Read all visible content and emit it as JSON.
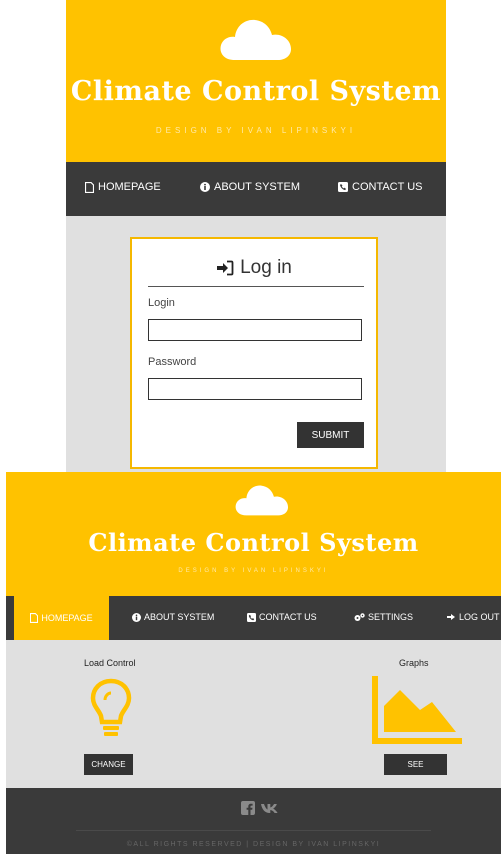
{
  "login_screen": {
    "header": {
      "title": "Climate Control System",
      "subtitle": "DESIGN BY IVAN LIPINSKYI"
    },
    "nav": [
      {
        "label": "HOMEPAGE",
        "icon": "file-icon"
      },
      {
        "label": "ABOUT SYSTEM",
        "icon": "info-icon"
      },
      {
        "label": "CONTACT US",
        "icon": "phone-icon"
      }
    ],
    "form": {
      "title": "Log in",
      "login_label": "Login",
      "login_value": "",
      "password_label": "Password",
      "password_value": "",
      "submit_label": "SUBMIT"
    }
  },
  "dashboard_screen": {
    "header": {
      "title": "Climate Control System",
      "subtitle": "DESIGN BY IVAN LIPINSKYI"
    },
    "nav": [
      {
        "label": "HOMEPAGE",
        "icon": "file-icon",
        "active": true
      },
      {
        "label": "ABOUT SYSTEM",
        "icon": "info-icon"
      },
      {
        "label": "CONTACT US",
        "icon": "phone-icon"
      },
      {
        "label": "SETTINGS",
        "icon": "gears-icon"
      },
      {
        "label": "LOG OUT",
        "icon": "sign-out-icon"
      }
    ],
    "features": [
      {
        "title": "Load Control",
        "icon": "lightbulb-icon",
        "button": "CHANGE"
      },
      {
        "title": "Graphs",
        "icon": "area-chart-icon",
        "button": "SEE"
      }
    ],
    "footer": {
      "social": [
        "facebook-icon",
        "vk-icon"
      ],
      "copyright": "©ALL RIGHTS RESERVED | DESIGN BY IVAN LIPINSKYI"
    }
  },
  "colors": {
    "accent": "#ffc200",
    "dark": "#3a3a3a",
    "background": "#e0e0e0"
  }
}
